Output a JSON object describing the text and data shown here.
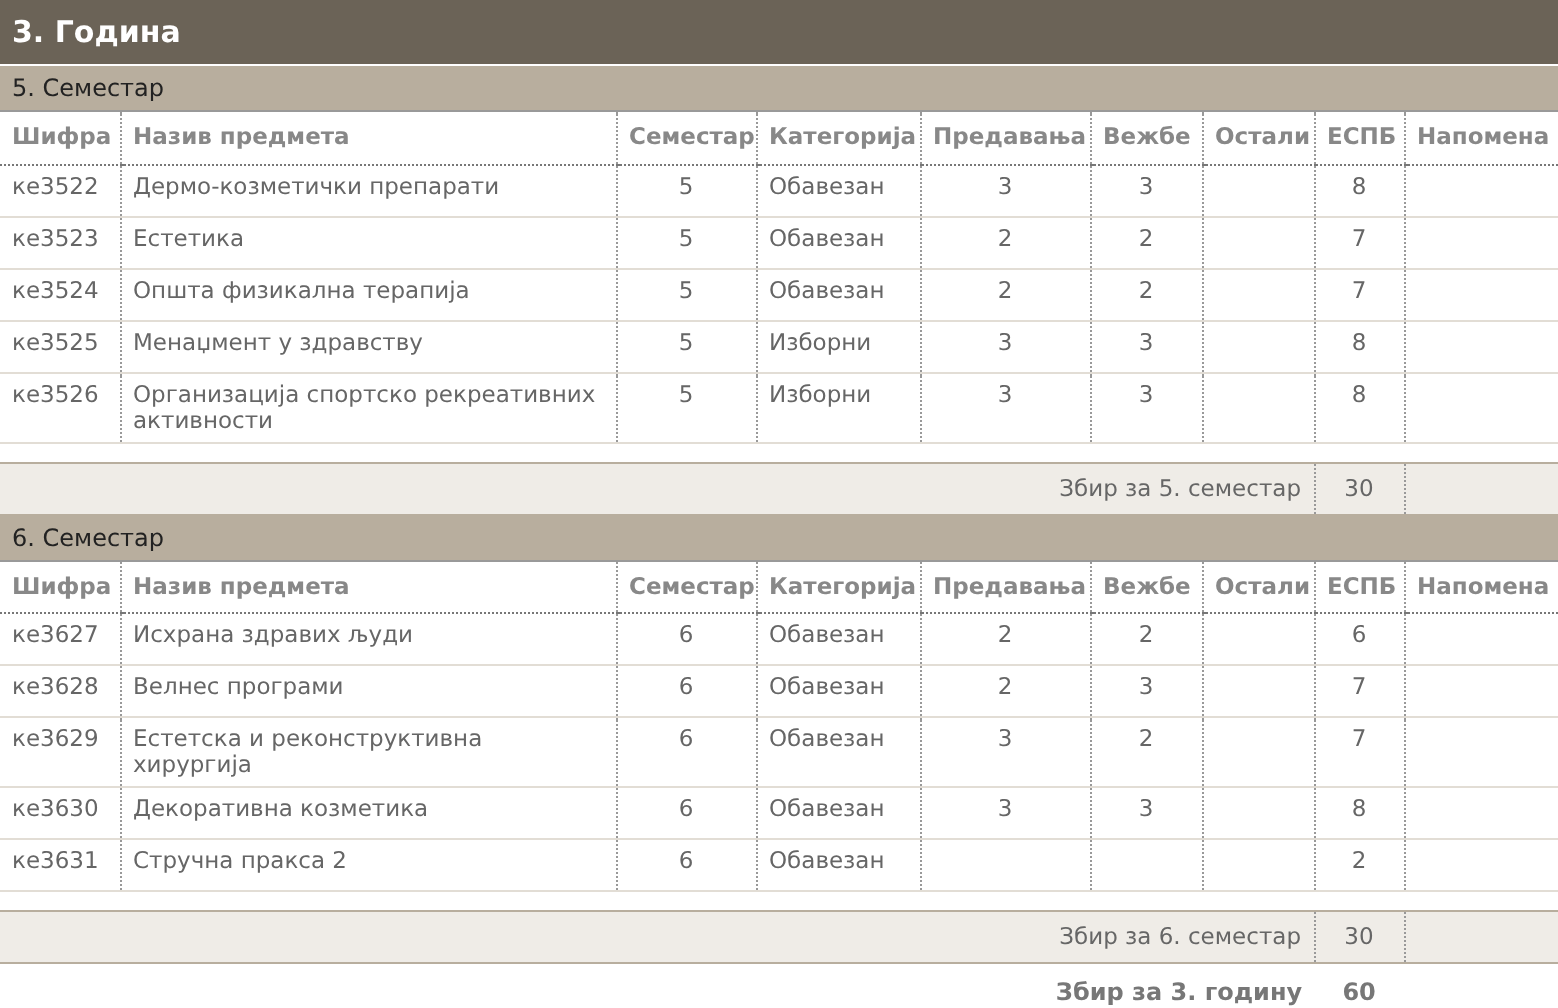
{
  "year": {
    "title": "3. Година"
  },
  "semesters": [
    {
      "title": "5. Семестар",
      "columns": [
        "Шифра",
        "Назив предмета",
        "Семестар",
        "Категорија",
        "Предавања",
        "Вежбе",
        "Остали",
        "ЕСПБ",
        "Напомена"
      ],
      "rows": [
        {
          "code": "ке3522",
          "name": "Дермо-козметички препарати",
          "semester": "5",
          "category": "Обавезан",
          "lectures": "3",
          "exercises": "3",
          "ects": "8"
        },
        {
          "code": "ке3523",
          "name": "Естетика",
          "semester": "5",
          "category": "Обавезан",
          "lectures": "2",
          "exercises": "2",
          "ects": "7"
        },
        {
          "code": "ке3524",
          "name": "Општа физикална терапија",
          "semester": "5",
          "category": "Обавезан",
          "lectures": "2",
          "exercises": "2",
          "ects": "7"
        },
        {
          "code": "ке3525",
          "name": "Менаџмент у здравству",
          "semester": "5",
          "category": "Изборни",
          "lectures": "3",
          "exercises": "3",
          "ects": "8"
        },
        {
          "code": "ке3526",
          "name": "Организација спортско рекреативних активности",
          "semester": "5",
          "category": "Изборни",
          "lectures": "3",
          "exercises": "3",
          "ects": "8"
        }
      ],
      "summary": {
        "label": "Збир за 5. семестар",
        "value": "30"
      }
    },
    {
      "title": "6. Семестар",
      "columns": [
        "Шифра",
        "Назив предмета",
        "Семестар",
        "Категорија",
        "Предавања",
        "Вежбе",
        "Остали",
        "ЕСПБ",
        "Напомена"
      ],
      "rows": [
        {
          "code": "ке3627",
          "name": "Исхрана здравих људи",
          "semester": "6",
          "category": "Обавезан",
          "lectures": "2",
          "exercises": "2",
          "ects": "6"
        },
        {
          "code": "ке3628",
          "name": "Велнес програми",
          "semester": "6",
          "category": "Обавезан",
          "lectures": "2",
          "exercises": "3",
          "ects": "7"
        },
        {
          "code": "ке3629",
          "name": "Естетска и реконструктивна хирургија",
          "semester": "6",
          "category": "Обавезан",
          "lectures": "3",
          "exercises": "2",
          "ects": "7"
        },
        {
          "code": "ке3630",
          "name": "Декоративна козметика",
          "semester": "6",
          "category": "Обавезан",
          "lectures": "3",
          "exercises": "3",
          "ects": "8"
        },
        {
          "code": "ке3631",
          "name": "Стручна пракса 2",
          "semester": "6",
          "category": "Обавезан",
          "ects": "2"
        }
      ],
      "summary": {
        "label": "Збир за 6. семестар",
        "value": "30"
      }
    }
  ],
  "total": {
    "label": "Збир за 3. годину",
    "value": "60"
  }
}
